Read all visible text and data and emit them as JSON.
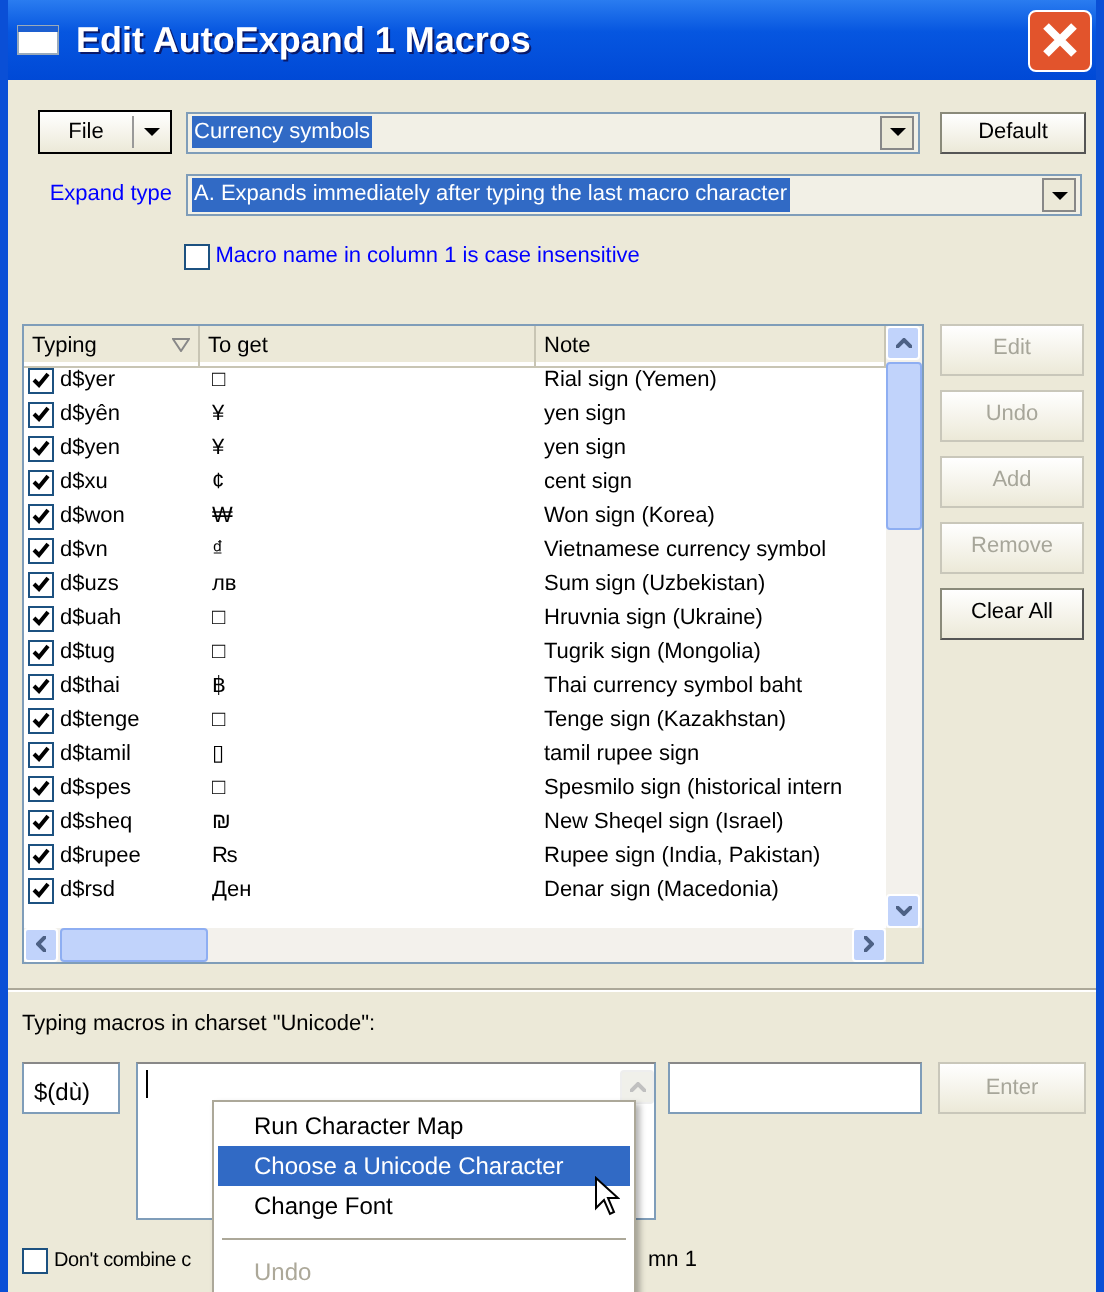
{
  "window": {
    "title": "Edit AutoExpand 1 Macros"
  },
  "file_button": {
    "label": "File"
  },
  "macro_set": {
    "value": "Currency symbols"
  },
  "default_button": {
    "label": "Default"
  },
  "expand_type": {
    "label": "Expand type",
    "value": "A. Expands immediately after typing the last macro character"
  },
  "case_option": {
    "label": "Macro name in column 1 is case insensitive",
    "checked": false
  },
  "table": {
    "columns": [
      "Typing",
      "To get",
      "Note"
    ],
    "rows": [
      {
        "typing": "d$yer",
        "to_get": "□",
        "note": "Rial sign (Yemen)",
        "checked": true
      },
      {
        "typing": "d$yên",
        "to_get": "¥",
        "note": "yen sign",
        "checked": true
      },
      {
        "typing": "d$yen",
        "to_get": "¥",
        "note": "yen sign",
        "checked": true
      },
      {
        "typing": "d$xu",
        "to_get": "¢",
        "note": "cent sign",
        "checked": true
      },
      {
        "typing": "d$won",
        "to_get": "₩",
        "note": "Won sign (Korea)",
        "checked": true
      },
      {
        "typing": "d$vn",
        "to_get": "₫",
        "note": "Vietnamese currency symbol",
        "checked": true
      },
      {
        "typing": "d$uzs",
        "to_get": "лв",
        "note": "Sum sign (Uzbekistan)",
        "checked": true
      },
      {
        "typing": "d$uah",
        "to_get": "□",
        "note": "Hruvnia sign (Ukraine)",
        "checked": true
      },
      {
        "typing": "d$tug",
        "to_get": "□",
        "note": "Tugrik sign (Mongolia)",
        "checked": true
      },
      {
        "typing": "d$thai",
        "to_get": "฿",
        "note": "Thai currency symbol baht",
        "checked": true
      },
      {
        "typing": "d$tenge",
        "to_get": "□",
        "note": "Tenge sign (Kazakhstan)",
        "checked": true
      },
      {
        "typing": "d$tamil",
        "to_get": "▯",
        "note": "tamil rupee sign",
        "checked": true
      },
      {
        "typing": "d$spes",
        "to_get": "□",
        "note": "Spesmilo sign (historical intern",
        "checked": true
      },
      {
        "typing": "d$sheq",
        "to_get": "₪",
        "note": "New Sheqel sign (Israel)",
        "checked": true
      },
      {
        "typing": "d$rupee",
        "to_get": "₨",
        "note": "Rupee sign (India, Pakistan)",
        "checked": true
      },
      {
        "typing": "d$rsd",
        "to_get": "Ден",
        "note": "Denar sign (Macedonia)",
        "checked": true
      }
    ]
  },
  "side_buttons": [
    {
      "label": "Edit",
      "disabled": true
    },
    {
      "label": "Undo",
      "disabled": true
    },
    {
      "label": "Add",
      "disabled": true
    },
    {
      "label": "Remove",
      "disabled": true
    },
    {
      "label": "Clear All",
      "disabled": false
    }
  ],
  "charset_label": "Typing macros in charset \"Unicode\":",
  "macro_name_field": {
    "value": "$(dù)"
  },
  "enter_button": {
    "label": "Enter",
    "disabled": true
  },
  "combine_option": {
    "label_start": "Don't combine c",
    "label_end": "mn 1",
    "checked": false
  },
  "context_menu": [
    {
      "kind": "item",
      "label": "Run Character Map",
      "selected": false,
      "disabled": false
    },
    {
      "kind": "item",
      "label": "Choose a Unicode Character",
      "selected": true,
      "disabled": false
    },
    {
      "kind": "item",
      "label": "Change Font",
      "selected": false,
      "disabled": false
    },
    {
      "kind": "separator"
    },
    {
      "kind": "item",
      "label": "Undo",
      "selected": false,
      "disabled": true
    }
  ]
}
